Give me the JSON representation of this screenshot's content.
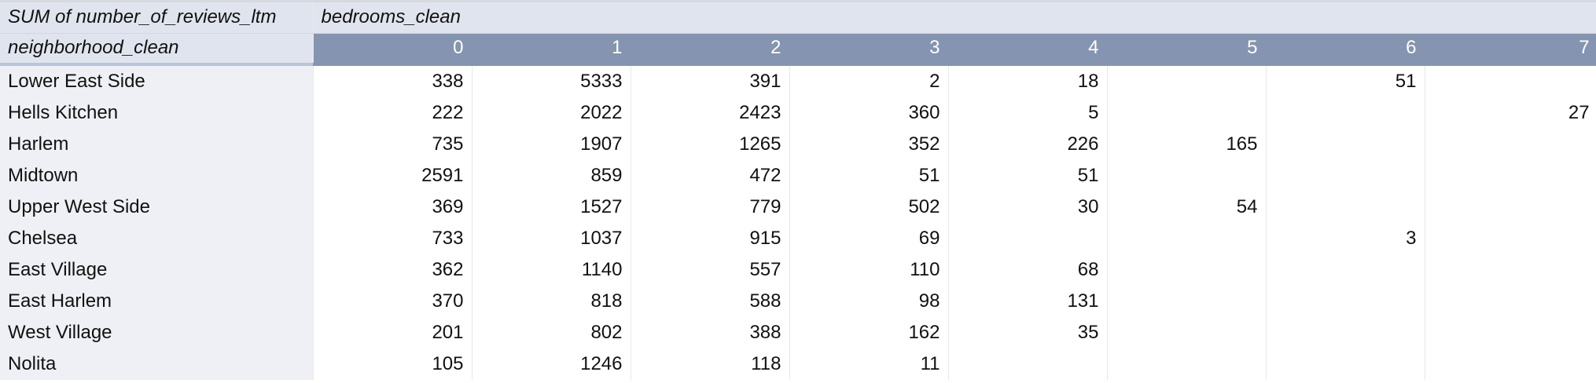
{
  "pivot": {
    "value_field": "SUM of number_of_reviews_ltm",
    "column_field": "bedrooms_clean",
    "row_field": "neighborhood_clean",
    "columns": [
      "0",
      "1",
      "2",
      "3",
      "4",
      "5",
      "6",
      "7"
    ],
    "rows": [
      {
        "label": "Lower East Side",
        "cells": [
          "338",
          "5333",
          "391",
          "2",
          "18",
          "",
          "51",
          ""
        ]
      },
      {
        "label": "Hells Kitchen",
        "cells": [
          "222",
          "2022",
          "2423",
          "360",
          "5",
          "",
          "",
          "27"
        ]
      },
      {
        "label": "Harlem",
        "cells": [
          "735",
          "1907",
          "1265",
          "352",
          "226",
          "165",
          "",
          ""
        ]
      },
      {
        "label": "Midtown",
        "cells": [
          "2591",
          "859",
          "472",
          "51",
          "51",
          "",
          "",
          ""
        ]
      },
      {
        "label": "Upper West Side",
        "cells": [
          "369",
          "1527",
          "779",
          "502",
          "30",
          "54",
          "",
          ""
        ]
      },
      {
        "label": "Chelsea",
        "cells": [
          "733",
          "1037",
          "915",
          "69",
          "",
          "",
          "3",
          ""
        ]
      },
      {
        "label": "East Village",
        "cells": [
          "362",
          "1140",
          "557",
          "110",
          "68",
          "",
          "",
          ""
        ]
      },
      {
        "label": "East Harlem",
        "cells": [
          "370",
          "818",
          "588",
          "98",
          "131",
          "",
          "",
          ""
        ]
      },
      {
        "label": "West Village",
        "cells": [
          "201",
          "802",
          "388",
          "162",
          "35",
          "",
          "",
          ""
        ]
      },
      {
        "label": "Nolita",
        "cells": [
          "105",
          "1246",
          "118",
          "11",
          "",
          "",
          "",
          ""
        ]
      }
    ]
  },
  "colors": {
    "header_bg": "#e0e4ee",
    "column_header_bg": "#8594b0",
    "row_label_bg": "#eef0f5"
  }
}
